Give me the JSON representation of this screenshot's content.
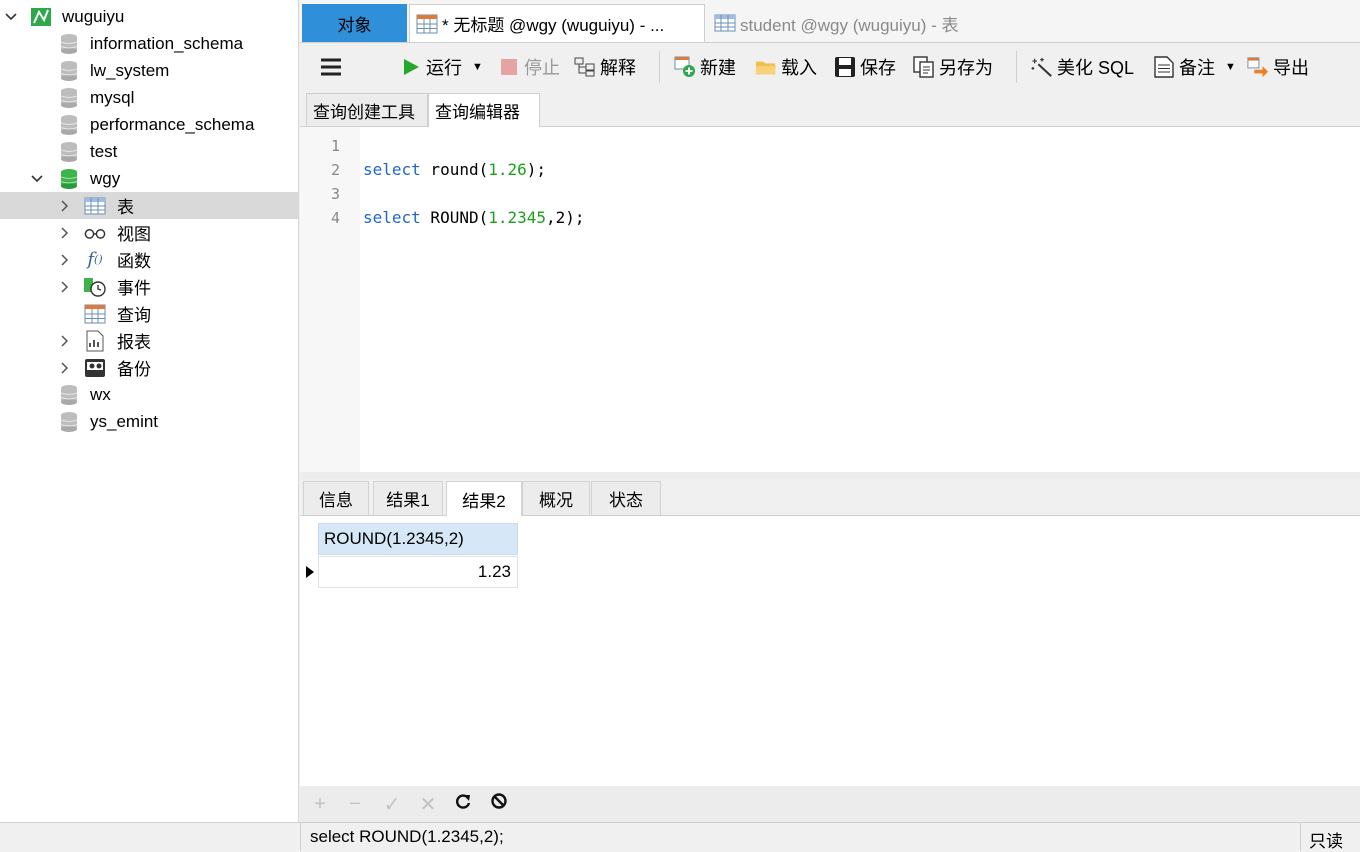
{
  "sidebar": {
    "connection": "wuguiyu",
    "databases": [
      "information_schema",
      "lw_system",
      "mysql",
      "performance_schema",
      "test"
    ],
    "open_db": "wgy",
    "children": [
      "表",
      "视图",
      "函数",
      "事件",
      "查询",
      "报表",
      "备份"
    ],
    "databases_after": [
      "wx",
      "ys_emint"
    ]
  },
  "tabs": {
    "objects": "对象",
    "untitled": "* 无标题 @wgy (wuguiyu) - ...",
    "student": "student @wgy (wuguiyu) - 表"
  },
  "toolbar": {
    "menu_icon": "hamburger-icon",
    "run": "运行",
    "stop": "停止",
    "explain": "解释",
    "new": "新建",
    "load": "载入",
    "save": "保存",
    "save_as": "另存为",
    "beautify": "美化 SQL",
    "comment": "备注",
    "export": "导出"
  },
  "subtabs": {
    "builder": "查询创建工具",
    "editor": "查询编辑器"
  },
  "editor": {
    "line_numbers": [
      "1",
      "2",
      "3",
      "4"
    ],
    "line2": {
      "kw": "select",
      "fn": " round(",
      "arg": "1.26",
      "end": ");"
    },
    "line4": {
      "kw": "select",
      "fn": " ROUND(",
      "arg": "1.2345",
      "end": ",2);"
    }
  },
  "result_tabs": [
    "信息",
    "结果1",
    "结果2",
    "概况",
    "状态"
  ],
  "result": {
    "column": "ROUND(1.2345,2)",
    "value": "1.23"
  },
  "grid_toolbar": {
    "add": "+",
    "remove": "−",
    "apply": "✓",
    "discard": "✕",
    "refresh": "refresh-icon",
    "stop": "stop-icon"
  },
  "status": {
    "sql": "select ROUND(1.2345,2);",
    "mode": "只读"
  },
  "colors": {
    "accent": "#2f8fd8",
    "selected_row": "#d9d9d9",
    "keyword": "#1f67c9",
    "number": "#19a319"
  }
}
